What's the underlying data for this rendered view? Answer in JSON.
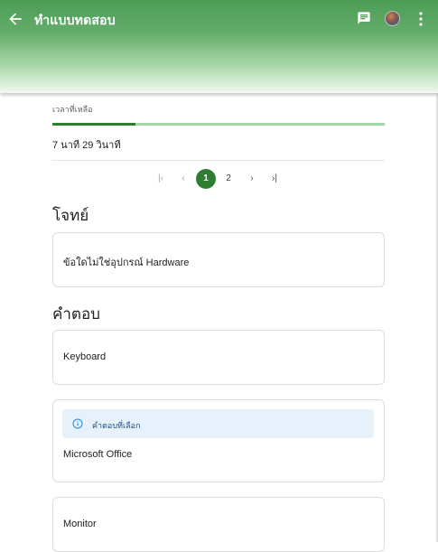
{
  "appbar": {
    "title": "ทำแบบทดสอบ",
    "icons": [
      "back-arrow-icon",
      "chat-icon",
      "avatar",
      "more-vert-icon"
    ],
    "color": "#4c9c56"
  },
  "timer": {
    "label": "เวลาที่เหลือ",
    "value": "7 นาที 29 วินาที",
    "remaining_fraction": 0.25
  },
  "pagination": {
    "first": "|‹",
    "prev": "‹",
    "pages": [
      "1",
      "2"
    ],
    "current": "1",
    "next": "›",
    "last": "›|"
  },
  "question": {
    "heading": "โจทย์",
    "text": "ข้อใดไม่ใช่อุปกรณ์ Hardware"
  },
  "answers": {
    "heading": "คำตอบ",
    "selected_label": "คำตอบที่เลือก",
    "options": [
      {
        "text": "Keyboard",
        "selected": false
      },
      {
        "text": "Microsoft Office",
        "selected": true
      },
      {
        "text": "Monitor",
        "selected": false
      }
    ]
  },
  "colors": {
    "accent": "#2e7d32",
    "progress_track": "#a5d6a7",
    "selected_bg": "#e6f1fb",
    "info": "#1e88e5"
  }
}
